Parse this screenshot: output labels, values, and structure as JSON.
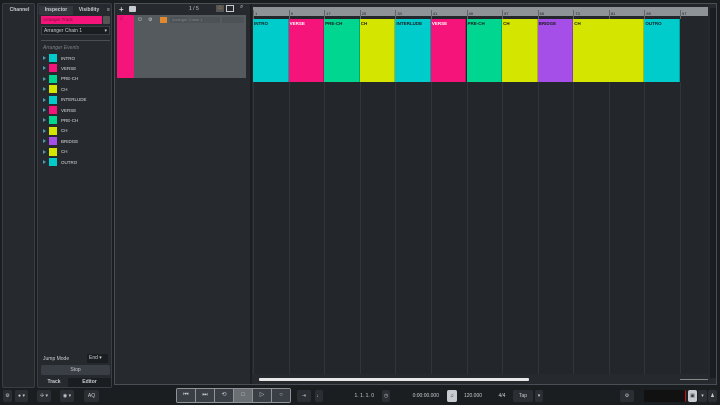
{
  "left_zone": {
    "channel_tab": "Channel",
    "inspector_tab": "Inspector",
    "visibility_tab": "Visibility",
    "track_tab": "Track",
    "editor_tab": "Editor"
  },
  "inspector": {
    "track_name": "Arranger Track",
    "chain_select": "Arranger Chain 1",
    "events_heading": "Arranger Events",
    "jump_mode_label": "Jump Mode",
    "jump_mode_value": "End",
    "stop_button": "Stop",
    "events": [
      {
        "label": "INTRO",
        "color": "#00cccc"
      },
      {
        "label": "VERSE",
        "color": "#f5157a"
      },
      {
        "label": "PRE-CH",
        "color": "#00d68f"
      },
      {
        "label": "CH",
        "color": "#d4e600"
      },
      {
        "label": "INTERLUDE",
        "color": "#00cccc"
      },
      {
        "label": "VERSE",
        "color": "#f5157a"
      },
      {
        "label": "PRE-CH",
        "color": "#00d68f"
      },
      {
        "label": "CH",
        "color": "#d4e600"
      },
      {
        "label": "BRIDGE",
        "color": "#a64ee8"
      },
      {
        "label": "CH",
        "color": "#d4e600"
      },
      {
        "label": "OUTRO",
        "color": "#00cccc"
      }
    ]
  },
  "project": {
    "track_count": "1 / 5",
    "track_chain": "Arranger Chain 1",
    "track_color": "#f5157a"
  },
  "ruler": [
    "1",
    "9",
    "17",
    "25",
    "33",
    "41",
    "49",
    "57",
    "65",
    "73",
    "81",
    "89",
    "97"
  ],
  "timeline_events": [
    {
      "label": "INTRO",
      "start": 1,
      "end": 9,
      "color": "#00cccc",
      "text": "#1b1e21"
    },
    {
      "label": "VERSE",
      "start": 9,
      "end": 17,
      "color": "#f5157a",
      "text": "#ffffff"
    },
    {
      "label": "PRE-CH",
      "start": 17,
      "end": 25,
      "color": "#00d68f",
      "text": "#1b1e21"
    },
    {
      "label": "CH",
      "start": 25,
      "end": 33,
      "color": "#d4e600",
      "text": "#1b1e21"
    },
    {
      "label": "INTERLUDE",
      "start": 33,
      "end": 41,
      "color": "#00cccc",
      "text": "#1b1e21"
    },
    {
      "label": "VERSE",
      "start": 41,
      "end": 49,
      "color": "#f5157a",
      "text": "#ffffff"
    },
    {
      "label": "PRE-CH",
      "start": 49,
      "end": 57,
      "color": "#00d68f",
      "text": "#1b1e21"
    },
    {
      "label": "CH",
      "start": 57,
      "end": 65,
      "color": "#d4e600",
      "text": "#1b1e21"
    },
    {
      "label": "BRIDGE",
      "start": 65,
      "end": 73,
      "color": "#a64ee8",
      "text": "#1b1e21"
    },
    {
      "label": "CH",
      "start": 73,
      "end": 89,
      "color": "#d4e600",
      "text": "#1b1e21"
    },
    {
      "label": "OUTRO",
      "start": 89,
      "end": 97,
      "color": "#00cccc",
      "text": "#1b1e21"
    }
  ],
  "transport": {
    "aq": "AQ",
    "position": "1. 1. 1. 0",
    "time": "0:00:00.000",
    "tempo": "120.000",
    "signature": "4/4",
    "tap": "Tap"
  }
}
